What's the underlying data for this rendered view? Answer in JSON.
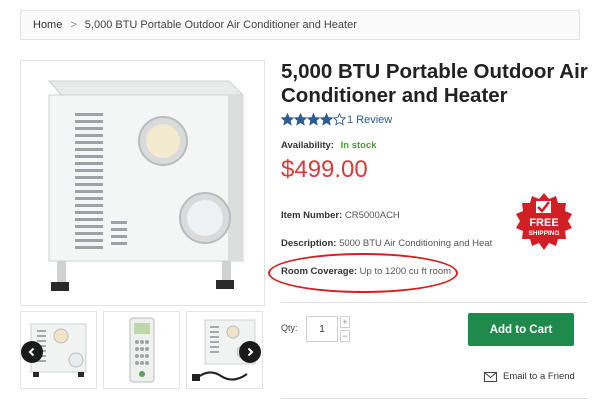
{
  "breadcrumb": {
    "home": "Home",
    "separator": ">",
    "current": "5,000 BTU Portable Outdoor Air Conditioner and Heater"
  },
  "product": {
    "title": "5,000 BTU Portable Outdoor Air Conditioner and Heater",
    "rating_stars": 4,
    "rating_max": 5,
    "reviews": "1 Review",
    "availability_label": "Availability:",
    "availability_value": "In stock",
    "price": "$499.00",
    "item_number_label": "Item Number:",
    "item_number_value": "CR5000ACH",
    "description_label": "Description:",
    "description_value": "5000 BTU Air Conditioning and Heat",
    "room_coverage_label": "Room Coverage:",
    "room_coverage_value": "Up to 1200 cu ft room"
  },
  "badge": {
    "line1": "FREE",
    "line2": "SHIPPING"
  },
  "cart": {
    "qty_label": "Qty:",
    "qty_value": "1",
    "plus": "+",
    "minus": "−",
    "add_to_cart": "Add to Cart"
  },
  "email": {
    "label": "Email to a Friend"
  },
  "colors": {
    "price": "#d83a3a",
    "in_stock": "#4c9a3a",
    "add_to_cart": "#1f8a4b",
    "star": "#2f5d93",
    "badge": "#d11f25",
    "highlight": "#d31f1f"
  }
}
